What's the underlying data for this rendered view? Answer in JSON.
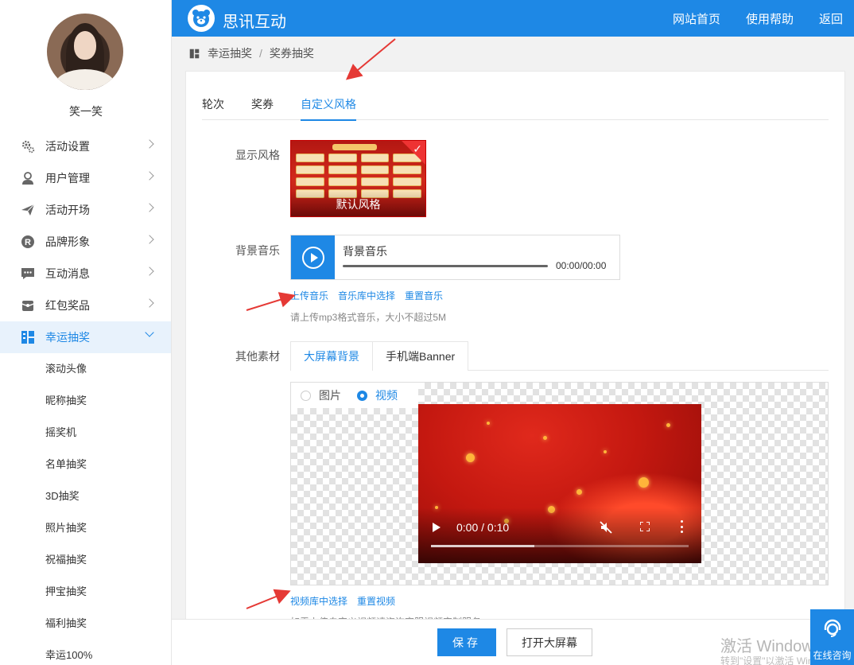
{
  "user": {
    "name": "笑一笑"
  },
  "sidebar": {
    "items": [
      {
        "label": "活动设置",
        "icon": "gears-icon"
      },
      {
        "label": "用户管理",
        "icon": "user-icon"
      },
      {
        "label": "活动开场",
        "icon": "paper-plane-icon"
      },
      {
        "label": "品牌形象",
        "icon": "registered-icon"
      },
      {
        "label": "互动消息",
        "icon": "chat-bubble-icon"
      },
      {
        "label": "红包奖品",
        "icon": "gift-icon"
      },
      {
        "label": "幸运抽奖",
        "icon": "lottery-icon",
        "active": true
      }
    ],
    "subitems": [
      "滚动头像",
      "昵称抽奖",
      "摇奖机",
      "名单抽奖",
      "3D抽奖",
      "照片抽奖",
      "祝福抽奖",
      "押宝抽奖",
      "福利抽奖",
      "幸运100%"
    ]
  },
  "topbar": {
    "brand": "思讯互动",
    "nav": [
      "网站首页",
      "使用帮助",
      "返回"
    ]
  },
  "breadcrumb": {
    "parent": "幸运抽奖",
    "separator": "/",
    "current": "奖券抽奖"
  },
  "tabs": [
    "轮次",
    "奖券",
    "自定义风格"
  ],
  "active_tab": "自定义风格",
  "display_style": {
    "label": "显示风格",
    "card_caption": "默认风格"
  },
  "bg_music": {
    "label": "背景音乐",
    "title": "背景音乐",
    "time": "00:00/00:00",
    "links": [
      "上传音乐",
      "音乐库中选择",
      "重置音乐"
    ],
    "hint": "请上传mp3格式音乐，大小不超过5M"
  },
  "other_assets": {
    "label": "其他素材",
    "tabs": [
      "大屏幕背景",
      "手机端Banner"
    ],
    "media_type_options": [
      "图片",
      "视频"
    ],
    "selected_media_type": "视频",
    "video": {
      "time": "0:00 / 0:10",
      "buffered_fraction": 0.4
    },
    "links": [
      "视频库中选择",
      "重置视频"
    ],
    "cut_hint": "如需上传自定义视频请咨询客服视频定制服务"
  },
  "footer": {
    "save": "保存",
    "open_big_screen": "打开大屏幕"
  },
  "watermark": {
    "line1": "激活 Windows",
    "line2": "转到\"设置\"以激活 Windows。"
  },
  "online_consult": {
    "label": "在线咨询"
  },
  "colors": {
    "primary": "#1e88e5",
    "annotation": "#e53935"
  }
}
